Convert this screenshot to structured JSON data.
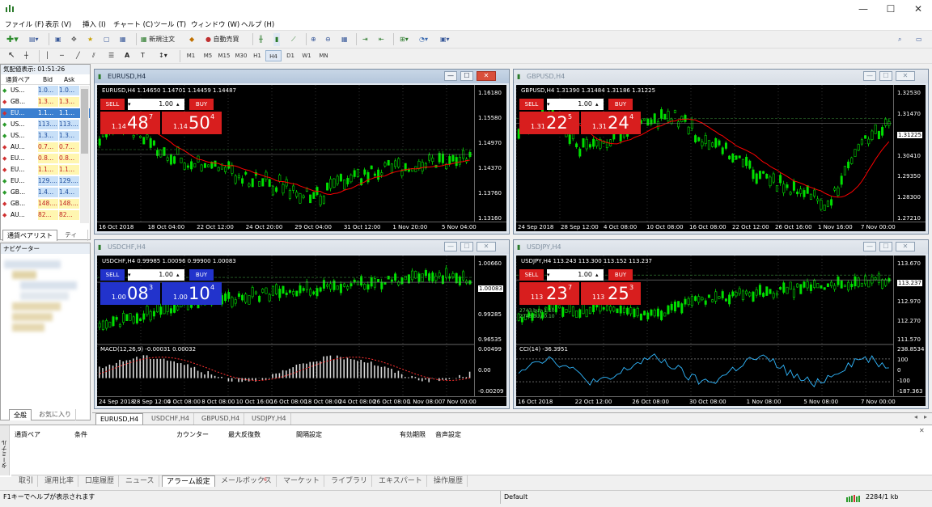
{
  "window": {
    "minimize": "—",
    "maximize": "☐",
    "close": "✕"
  },
  "menu": [
    "ファイル (F)",
    "表示 (V)",
    "挿入 (I)",
    "チャート (C)",
    "ツール (T)",
    "ウィンドウ (W)",
    "ヘルプ (H)"
  ],
  "toolbar": {
    "new_order": "新規注文",
    "auto_trading": "自動売買"
  },
  "timeframes": [
    "M1",
    "M5",
    "M15",
    "M30",
    "H1",
    "H4",
    "D1",
    "W1",
    "MN"
  ],
  "active_timeframe": "H4",
  "market_watch": {
    "title": "気配値表示: 01:51:26",
    "headers": [
      "通貨ペア",
      "Bid",
      "Ask"
    ],
    "rows": [
      {
        "sym": "US...",
        "bid": "1.0...",
        "ask": "1.0...",
        "dir": "up"
      },
      {
        "sym": "GB...",
        "bid": "1.3...",
        "ask": "1.3...",
        "dir": "down"
      },
      {
        "sym": "EU...",
        "bid": "1.1...",
        "ask": "1.1...",
        "dir": "down",
        "selected": true
      },
      {
        "sym": "US...",
        "bid": "113....",
        "ask": "113....",
        "dir": "up"
      },
      {
        "sym": "US...",
        "bid": "1.3...",
        "ask": "1.3...",
        "dir": "up"
      },
      {
        "sym": "AU...",
        "bid": "0.7...",
        "ask": "0.7...",
        "dir": "down"
      },
      {
        "sym": "EU...",
        "bid": "0.8...",
        "ask": "0.8...",
        "dir": "down"
      },
      {
        "sym": "EU...",
        "bid": "1.1...",
        "ask": "1.1...",
        "dir": "down"
      },
      {
        "sym": "EU...",
        "bid": "129....",
        "ask": "129....",
        "dir": "up"
      },
      {
        "sym": "GB...",
        "bid": "1.4...",
        "ask": "1.4...",
        "dir": "up"
      },
      {
        "sym": "GB...",
        "bid": "148....",
        "ask": "148....",
        "dir": "down"
      },
      {
        "sym": "AU...",
        "bid": "82...",
        "ask": "82...",
        "dir": "down"
      }
    ],
    "tabs": [
      "通貨ペアリスト",
      "ティック"
    ]
  },
  "navigator": {
    "title": "ナビゲーター",
    "tabs": [
      "全般",
      "お気に入り"
    ]
  },
  "trade_panel": {
    "sell": "SELL",
    "buy": "BUY",
    "volume": "1.00"
  },
  "charts": [
    {
      "title": "EURUSD,H4",
      "ohlc": "EURUSD,H4  1.14650 1.14701 1.14459 1.14487",
      "sell_small": "1.14",
      "sell_big": "48",
      "sell_sup": "7",
      "buy_small": "1.14",
      "buy_big": "50",
      "buy_sup": "4",
      "prices": [
        "1.16180",
        "1.15580",
        "1.14970",
        "1.14370",
        "1.13760",
        "1.13160"
      ],
      "current": "1.14487",
      "dates": [
        "16 Oct 2018",
        "18 Oct 04:00",
        "22 Oct 12:00",
        "24 Oct 20:00",
        "29 Oct 04:00",
        "31 Oct 12:00",
        "1 Nov 20:00",
        "5 Nov 04:00"
      ],
      "active": true
    },
    {
      "title": "GBPUSD,H4",
      "ohlc": "GBPUSD,H4  1.31390 1.31484 1.31186 1.31225",
      "sell_small": "1.31",
      "sell_big": "22",
      "sell_sup": "5",
      "buy_small": "1.31",
      "buy_big": "24",
      "buy_sup": "4",
      "prices": [
        "1.32530",
        "1.31470",
        "1.31225",
        "1.30410",
        "1.29350",
        "1.28300",
        "1.27210"
      ],
      "current": "1.31225",
      "dates": [
        "24 Sep 2018",
        "28 Sep 12:00",
        "4 Oct 08:00",
        "10 Oct 08:00",
        "16 Oct 08:00",
        "22 Oct 12:00",
        "26 Oct 16:00",
        "1 Nov 16:00",
        "7 Nov 00:00"
      ]
    },
    {
      "title": "USDCHF,H4",
      "ohlc": "USDCHF,H4  0.99985 1.00096 0.99900 1.00083",
      "sell_small": "1.00",
      "sell_big": "08",
      "sell_sup": "3",
      "buy_small": "1.00",
      "buy_big": "10",
      "buy_sup": "4",
      "prices": [
        "1.00660",
        "1.00083",
        "0.99285",
        "0.96535"
      ],
      "current": "1.00083",
      "macd_label": "MACD(12,26,9) -0.00031 0.00032",
      "macd_axis": [
        "0.00499",
        "0.00",
        "-0.00209"
      ],
      "dates": [
        "24 Sep 2018",
        "28 Sep 12:00",
        "4 Oct 08:00",
        "8 Oct 08:00",
        "10 Oct 16:00",
        "16 Oct 08:00",
        "18 Oct 08:00",
        "24 Oct 08:00",
        "26 Oct 08:00",
        "1 Nov 08:00",
        "7 Nov 00:00"
      ]
    },
    {
      "title": "USDJPY,H4",
      "ohlc": "USDJPY,H4  113.243 113.300 113.152 113.237",
      "sell_small": "113",
      "sell_big": "23",
      "sell_sup": "7",
      "buy_small": "113",
      "buy_big": "25",
      "buy_sup": "3",
      "prices": [
        "113.670",
        "113.237",
        "112.970",
        "112.270",
        "111.570"
      ],
      "current": "113.237",
      "cci_label": "CCI(14) -36.3951",
      "cci_axis": [
        "238.8534",
        "100",
        "0",
        "-100",
        "-187.363"
      ],
      "levels": [
        "2743 buy 1.10",
        "2743 buy 0.10"
      ],
      "dates": [
        "16 Oct 2018",
        "22 Oct 12:00",
        "26 Oct 08:00",
        "30 Oct 08:00",
        "1 Nov 08:00",
        "5 Nov 08:00",
        "7 Nov 00:00"
      ]
    }
  ],
  "chart_tabs": [
    "EURUSD,H4",
    "USDCHF,H4",
    "GBPUSD,H4",
    "USDJPY,H4"
  ],
  "terminal": {
    "headers": [
      "通貨ペア",
      "条件",
      "カウンター",
      "最大反復数",
      "間隔設定",
      "有効期限",
      "音声設定"
    ],
    "side_label": "ターミナル",
    "tabs": [
      "取引",
      "運用比率",
      "口座履歴",
      "ニュース",
      "アラーム設定",
      "メールボックス",
      "マーケット",
      "ライブラリ",
      "エキスパート",
      "操作履歴"
    ],
    "active_tab": "アラーム設定",
    "mail_badge": "6"
  },
  "status": {
    "help": "F1キーでヘルプが表示されます",
    "profile": "Default",
    "traffic": "2284/1 kb"
  },
  "colors": {
    "sell": "#d81e1e",
    "buy": "#d81e1e",
    "chf_trade": "#2233cc",
    "candle": "#00e000",
    "ma": "#ff0000"
  }
}
